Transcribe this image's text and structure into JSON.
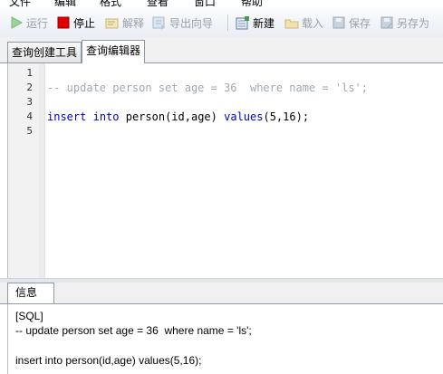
{
  "menu": [
    "文件",
    "编辑",
    "格式",
    "查看",
    "窗口",
    "帮助"
  ],
  "toolbar": {
    "run": "运行",
    "stop": "停止",
    "explain": "解释",
    "export_wizard": "导出向导",
    "new": "新建",
    "load": "载入",
    "save": "保存",
    "save_as": "另存为"
  },
  "tabs": {
    "query_builder": "查询创建工具",
    "query_editor": "查询编辑器"
  },
  "editor": {
    "line_numbers": [
      "1",
      "2",
      "3",
      "4",
      "5"
    ],
    "line2_comment": "-- update person set age = 36  where name = 'ls';",
    "line4": {
      "kw_insert": "insert",
      "kw_into": "into",
      "table_part": "person(id,age)",
      "kw_values": "values",
      "values_part": "(5,16);"
    }
  },
  "info": {
    "tab_label": "信息",
    "lines": [
      "[SQL]",
      "-- update person set age = 36  where name = 'ls';",
      "",
      "insert into person(id,age) values(5,16);"
    ]
  },
  "colors": {
    "keyword": "#0000c0",
    "comment": "#a0a8b4",
    "stop_icon": "#e00000"
  }
}
